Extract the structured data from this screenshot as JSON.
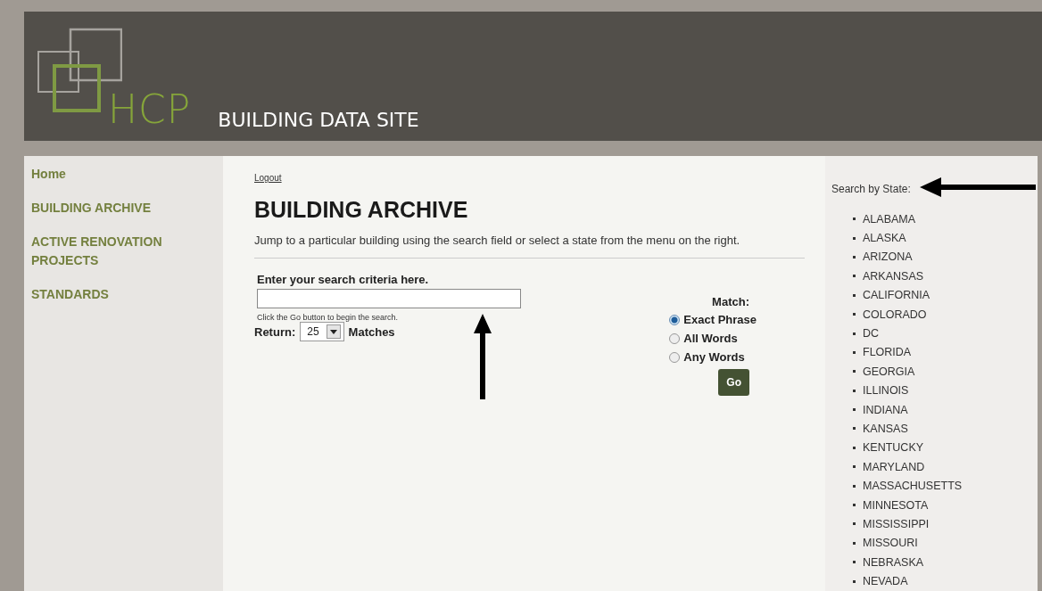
{
  "header": {
    "logo_text": "HCP",
    "site_title": "BUILDING DATA SITE"
  },
  "sidebar": {
    "items": [
      {
        "label": "Home"
      },
      {
        "label": "BUILDING ARCHIVE"
      },
      {
        "label": "ACTIVE RENOVATION PROJECTS"
      },
      {
        "label": "STANDARDS"
      }
    ]
  },
  "main": {
    "logout": "Logout",
    "title": "BUILDING ARCHIVE",
    "intro": "Jump to a particular building using the search field or select a state from the menu on the right.",
    "search": {
      "label": "Enter your search criteria here.",
      "hint": "Click the Go button to begin the search.",
      "return_label": "Return:",
      "return_value": "25",
      "matches_label": "Matches"
    },
    "match": {
      "label": "Match:",
      "options": [
        {
          "label": "Exact Phrase",
          "selected": true
        },
        {
          "label": "All Words",
          "selected": false
        },
        {
          "label": "Any Words",
          "selected": false
        }
      ],
      "button": "Go"
    }
  },
  "state_menu": {
    "title": "Search by State:",
    "states": [
      "ALABAMA",
      "ALASKA",
      "ARIZONA",
      "ARKANSAS",
      "CALIFORNIA",
      "COLORADO",
      "DC",
      "FLORIDA",
      "GEORGIA",
      "ILLINOIS",
      "INDIANA",
      "KANSAS",
      "KENTUCKY",
      "MARYLAND",
      "MASSACHUSETTS",
      "MINNESOTA",
      "MISSISSIPPI",
      "MISSOURI",
      "NEBRASKA",
      "NEVADA"
    ]
  }
}
